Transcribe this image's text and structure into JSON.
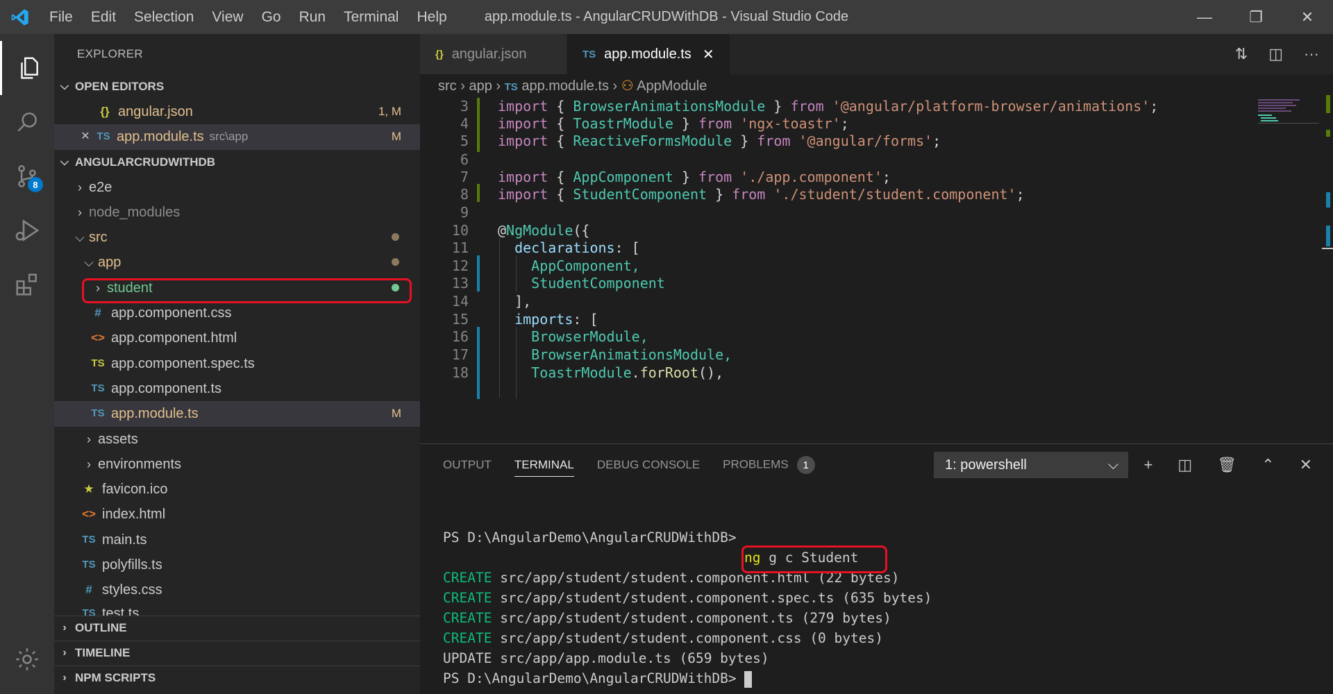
{
  "titlebar": {
    "menu": [
      "File",
      "Edit",
      "Selection",
      "View",
      "Go",
      "Run",
      "Terminal",
      "Help"
    ],
    "title": "app.module.ts - AngularCRUDWithDB - Visual Studio Code"
  },
  "activitybar": {
    "scm_badge": "8"
  },
  "explorer": {
    "title": "EXPLORER",
    "open_editors_header": "OPEN EDITORS",
    "open_editors": [
      {
        "icon": "{}",
        "name": "angular.json",
        "status": "1, M"
      },
      {
        "icon": "TS",
        "name": "app.module.ts",
        "path": "src\\app",
        "status": "M"
      }
    ],
    "project_header": "ANGULARCRUDWITHDB",
    "tree": {
      "e2e": "e2e",
      "node_modules": "node_modules",
      "src": "src",
      "app": "app",
      "student": "student",
      "app_css": "app.component.css",
      "app_html": "app.component.html",
      "app_spec": "app.component.spec.ts",
      "app_ts": "app.component.ts",
      "app_module": "app.module.ts",
      "app_module_status": "M",
      "assets": "assets",
      "environments": "environments",
      "favicon": "favicon.ico",
      "index": "index.html",
      "main": "main.ts",
      "polyfills": "polyfills.ts",
      "styles": "styles.css",
      "test": "test.ts"
    },
    "outline": "OUTLINE",
    "timeline": "TIMELINE",
    "npm": "NPM SCRIPTS",
    "icons": {
      "ts": "TS",
      "css": "#",
      "html": "<>",
      "json": "{}",
      "star": "★"
    }
  },
  "editor": {
    "tabs": [
      {
        "icon": "{}",
        "label": "angular.json"
      },
      {
        "icon": "TS",
        "label": "app.module.ts"
      }
    ],
    "breadcrumb": {
      "src": "src",
      "app": "app",
      "ts": "TS",
      "file": "app.module.ts",
      "symbol": "AppModule"
    },
    "line_numbers": [
      "3",
      "4",
      "5",
      "6",
      "7",
      "8",
      "9",
      "10",
      "11",
      "12",
      "13",
      "14",
      "15",
      "16",
      "17",
      "18"
    ],
    "code": {
      "l3a": "import",
      "l3b": " { ",
      "l3c": "BrowserAnimationsModule",
      "l3d": " } ",
      "l3e": "from",
      "l3f": " ",
      "l3g": "'@angular/platform-browser/animations'",
      "l3h": ";",
      "l4a": "import",
      "l4b": " { ",
      "l4c": "ToastrModule",
      "l4d": " } ",
      "l4e": "from",
      "l4f": " ",
      "l4g": "'ngx-toastr'",
      "l4h": ";",
      "l5a": "import",
      "l5b": " { ",
      "l5c": "ReactiveFormsModule",
      "l5d": " } ",
      "l5e": "from",
      "l5f": " ",
      "l5g": "'@angular/forms'",
      "l5h": ";",
      "l7a": "import",
      "l7b": " { ",
      "l7c": "AppComponent",
      "l7d": " } ",
      "l7e": "from",
      "l7f": " ",
      "l7g": "'./app.component'",
      "l7h": ";",
      "l8a": "import",
      "l8b": " { ",
      "l8c": "StudentComponent",
      "l8d": " } ",
      "l8e": "from",
      "l8f": " ",
      "l8g": "'./student/student.component'",
      "l8h": ";",
      "l10a": "@",
      "l10b": "NgModule",
      "l10c": "({",
      "l11a": "  ",
      "l11b": "declarations",
      "l11c": ": [",
      "l12": "    AppComponent,",
      "l13": "    StudentComponent",
      "l14": "  ],",
      "l15a": "  ",
      "l15b": "imports",
      "l15c": ": [",
      "l16": "    BrowserModule,",
      "l17": "    BrowserAnimationsModule,",
      "l18a": "    ToastrModule",
      "l18b": ".",
      "l18c": "forRoot",
      "l18d": "(),"
    }
  },
  "panel": {
    "tabs": [
      "OUTPUT",
      "TERMINAL",
      "DEBUG CONSOLE",
      "PROBLEMS"
    ],
    "problems_count": "1",
    "terminal_select": "1: powershell",
    "terminal": {
      "prompt1": "PS D:\\AngularDemo\\AngularCRUDWithDB>",
      "cmd_ng": "ng",
      "cmd_rest": " g c Student",
      "lines": [
        {
          "verb": "CREATE",
          "text": " src/app/student/student.component.html (22 bytes)"
        },
        {
          "verb": "CREATE",
          "text": " src/app/student/student.component.spec.ts (635 bytes)"
        },
        {
          "verb": "CREATE",
          "text": " src/app/student/student.component.ts (279 bytes)"
        },
        {
          "verb": "CREATE",
          "text": " src/app/student/student.component.css (0 bytes)"
        },
        {
          "verb": "UPDATE",
          "text": " src/app/app.module.ts (659 bytes)"
        }
      ],
      "prompt2": "PS D:\\AngularDemo\\AngularCRUDWithDB>"
    }
  }
}
